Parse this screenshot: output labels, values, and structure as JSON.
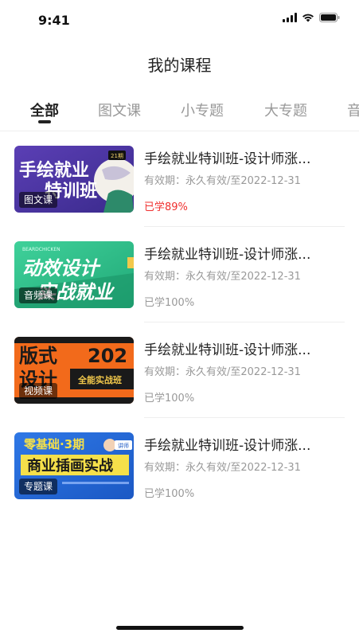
{
  "status_bar": {
    "time": "9:41",
    "icons": [
      "signal-icon",
      "wifi-icon",
      "battery-icon"
    ]
  },
  "header": {
    "title": "我的课程"
  },
  "tabs": [
    {
      "label": "全部",
      "active": true
    },
    {
      "label": "图文课",
      "active": false
    },
    {
      "label": "小专题",
      "active": false
    },
    {
      "label": "大专题",
      "active": false
    },
    {
      "label": "音",
      "active": false
    }
  ],
  "courses": [
    {
      "title": "手绘就业特训班-设计师涨...",
      "type_tag": "图文课",
      "validity": "有效期：永久有效/至2022-12-31",
      "progress": "已学89%",
      "thumb_text": [
        "手绘就业",
        "特训班"
      ],
      "thumb_badge": "21期"
    },
    {
      "title": "手绘就业特训班-设计师涨...",
      "type_tag": "音频课",
      "validity": "有效期：永久有效/至2022-12-31",
      "progress": "已学100%",
      "thumb_text": [
        "动效设计",
        "实战就业"
      ],
      "thumb_badge": "BEARDCHICKEN"
    },
    {
      "title": "手绘就业特训班-设计师涨...",
      "type_tag": "视频课",
      "validity": "有效期：永久有效/至2022-12-31",
      "progress": "已学100%",
      "thumb_text": [
        "版式",
        "设计",
        "全能实战班"
      ],
      "thumb_badge": "202"
    },
    {
      "title": "手绘就业特训班-设计师涨...",
      "type_tag": "专题课",
      "validity": "有效期：永久有效/至2022-12-31",
      "progress": "已学100%",
      "thumb_text": [
        "零基础·3期",
        "商业插画实战"
      ],
      "thumb_badge": "讲师"
    }
  ],
  "colors": {
    "accent_red": "#f0302f",
    "text_primary": "#222222",
    "text_secondary": "#999999"
  }
}
